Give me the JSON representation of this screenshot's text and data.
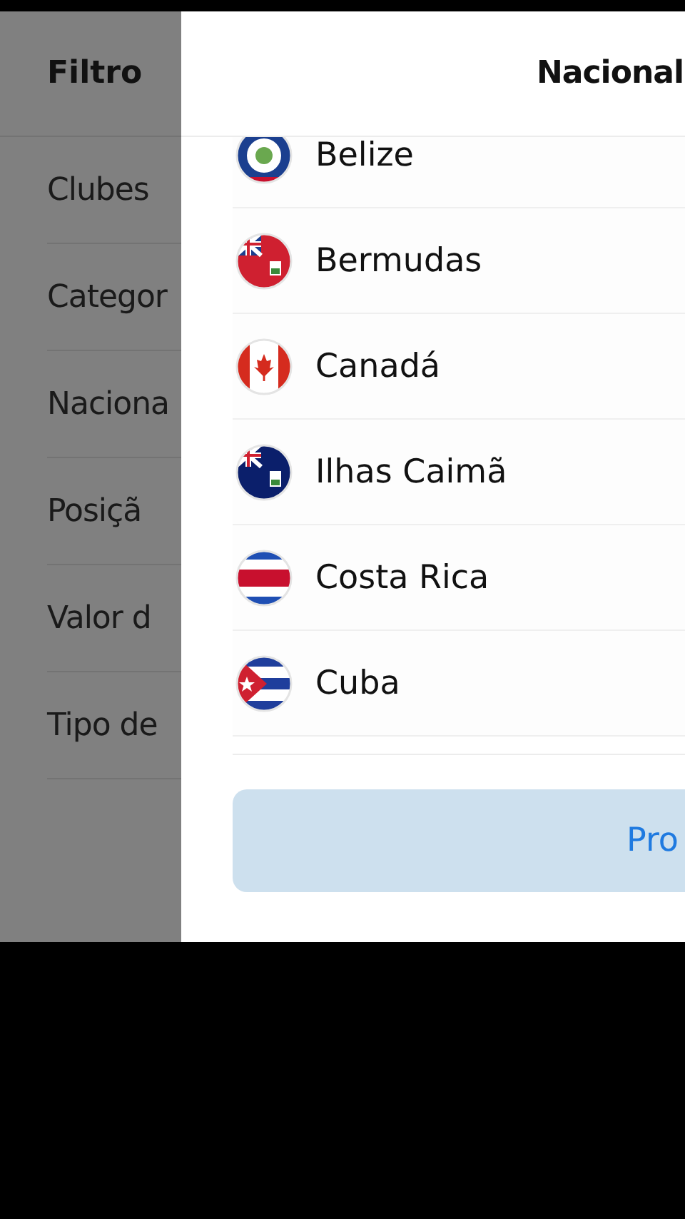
{
  "filter_panel": {
    "title": "Filtro",
    "items": [
      "Clubes",
      "Categor",
      "Naciona",
      "Posiçã",
      "Valor d",
      "Tipo de"
    ]
  },
  "sheet": {
    "title": "Nacional",
    "countries": [
      "Belize",
      "Bermudas",
      "Canadá",
      "Ilhas Caimã",
      "Costa Rica",
      "Cuba"
    ],
    "button": "Pro"
  }
}
